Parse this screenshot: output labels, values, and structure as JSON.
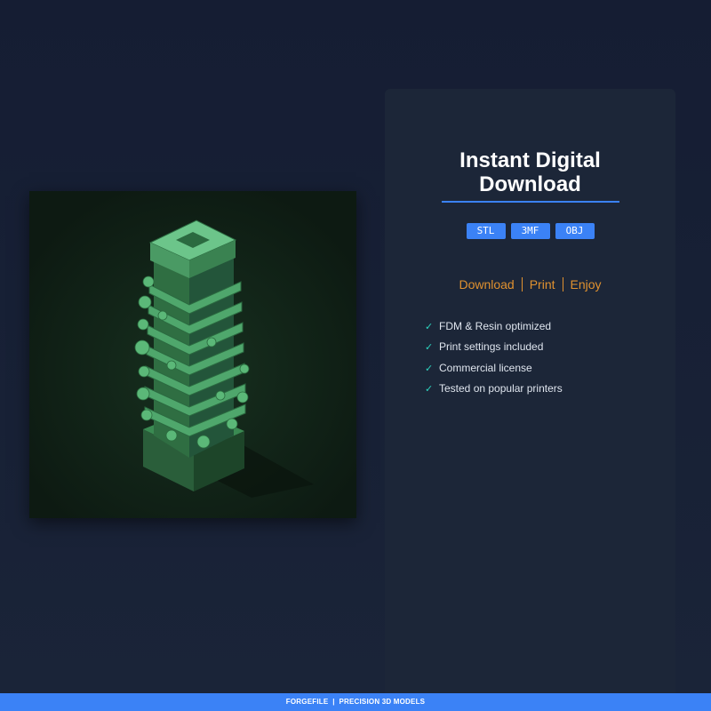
{
  "panel": {
    "title_line1": "Instant Digital",
    "title_line2": "Download",
    "formats": [
      "STL",
      "3MF",
      "OBJ"
    ],
    "steps": [
      "Download",
      "Print",
      "Enjoy"
    ],
    "features": [
      "FDM & Resin optimized",
      "Print settings included",
      "Commercial license",
      "Tested on popular printers"
    ],
    "check_icon": "✓"
  },
  "footer": {
    "text": "FORGEFILE  |  PRECISION 3D MODELS"
  },
  "colors": {
    "accent": "#3b82f6",
    "steps": "#e0912f",
    "check": "#2dd4bf",
    "panel": "#1c2638",
    "model": "#4fa76c"
  }
}
